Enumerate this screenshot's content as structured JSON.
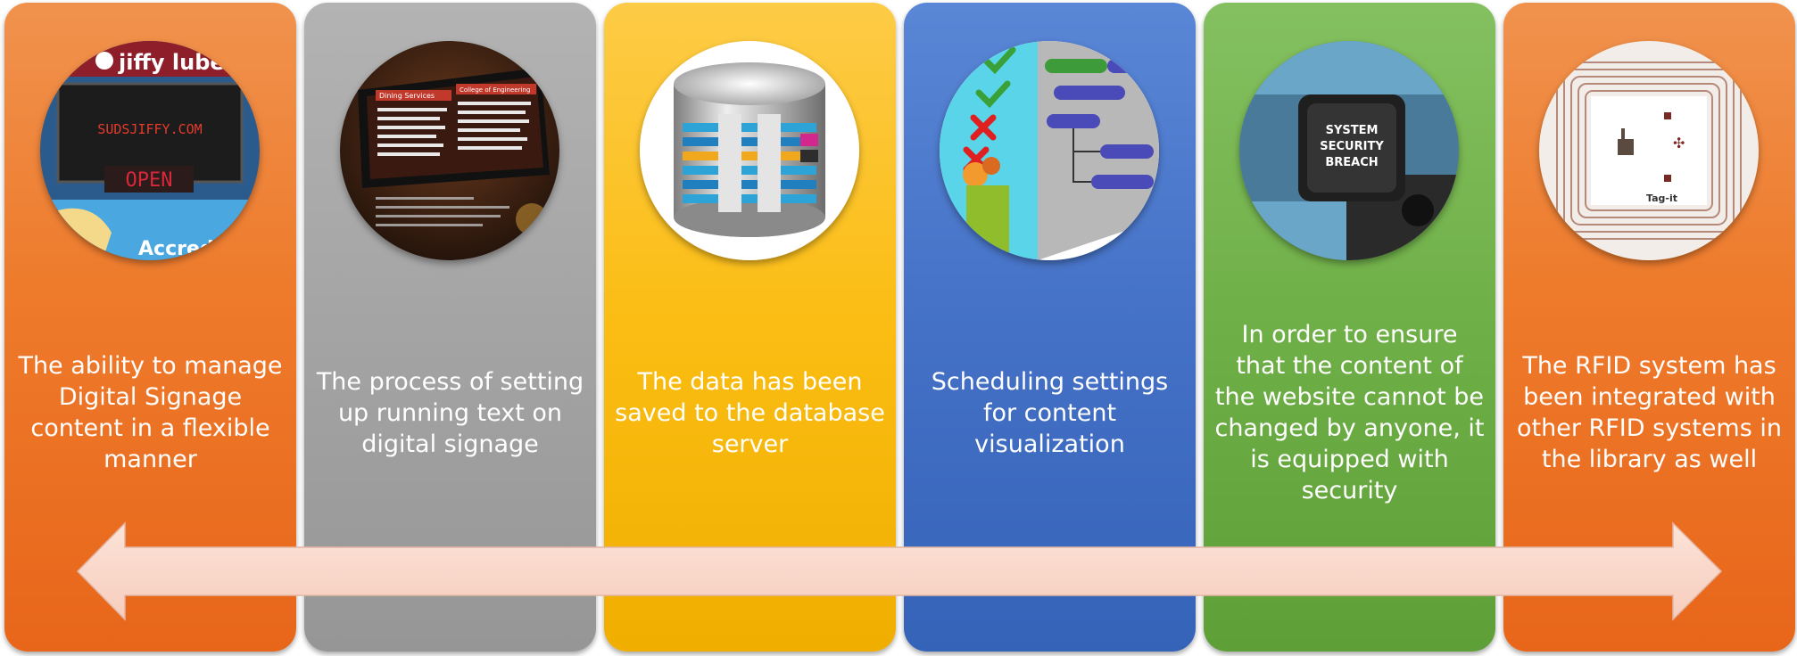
{
  "panels": [
    {
      "text": "The ability to manage Digital Signage content in a flexible manner",
      "image_icon": "digital-signage-photo",
      "image_text": {
        "brand": "jiffy lube",
        "marquee": "SUDSJIFFY.COM",
        "sign": "OPEN",
        "banner": "Accredi"
      }
    },
    {
      "text": "The process of setting up running text on digital signage",
      "image_icon": "running-text-display-photo",
      "image_text": {
        "left_header": "Dining Services",
        "right_header": "College of Engineering"
      }
    },
    {
      "text": "The data has been saved to the database server",
      "image_icon": "database-icon"
    },
    {
      "text": "Scheduling settings for content visualization",
      "image_icon": "schedule-checklist-icon"
    },
    {
      "text": "In order to ensure that the content of the website cannot be changed by anyone, it is equipped with security",
      "image_icon": "security-breach-button-photo",
      "image_text": {
        "button_line1": "SYSTEM",
        "button_line2": "SECURITY",
        "button_line3": "BREACH"
      }
    },
    {
      "text": "The RFID system has been integrated with other RFID systems in the library as well",
      "image_icon": "rfid-tag-photo",
      "image_text": {
        "tag_label": "Tag-it"
      }
    }
  ],
  "colors": {
    "orange": "#ee7a2b",
    "gray": "#a4a4a4",
    "yellow": "#fbbd13",
    "blue": "#4471c6",
    "green": "#6faf47",
    "arrow_fill": "#f9d8cb",
    "text": "#ffffff"
  },
  "arrow_icon": "double-headed-arrow-icon"
}
